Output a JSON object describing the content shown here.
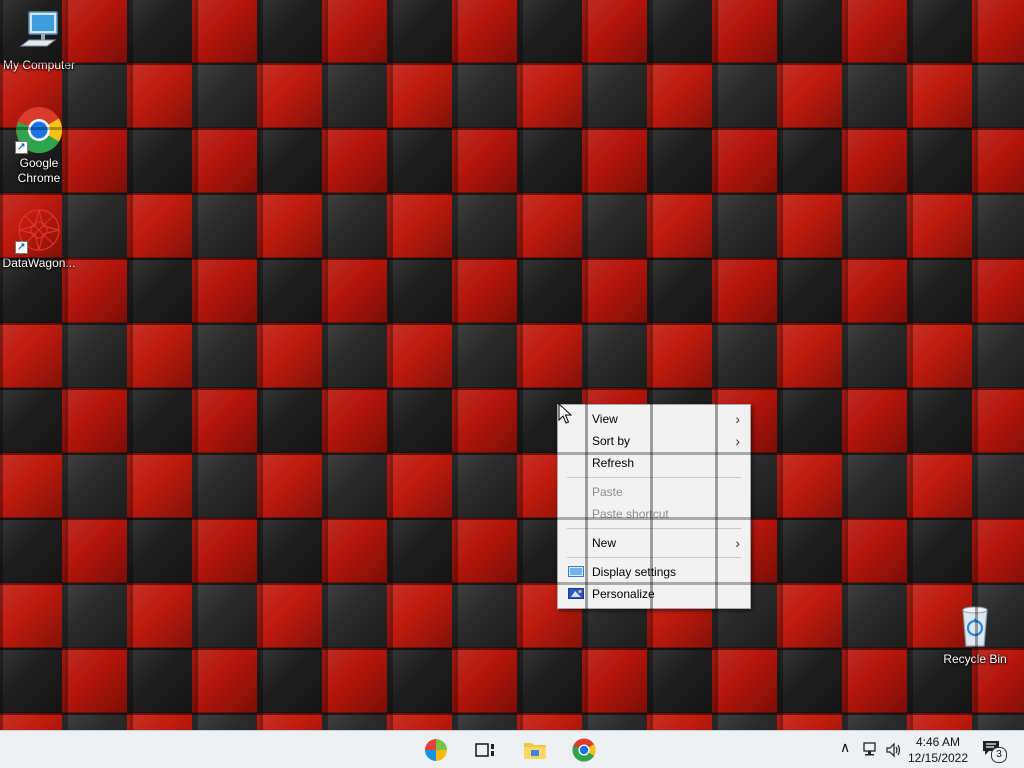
{
  "desktop_icons": [
    {
      "label": "My Computer",
      "icon": "computer-icon"
    },
    {
      "label": "Google Chrome",
      "icon": "chrome-icon"
    },
    {
      "label": "DataWagon...",
      "icon": "datawagon-icon"
    },
    {
      "label": "Recycle Bin",
      "icon": "recycle-bin-icon"
    }
  ],
  "context_menu": {
    "items": [
      {
        "label": "View",
        "submenu": true,
        "enabled": true
      },
      {
        "label": "Sort by",
        "submenu": true,
        "enabled": true
      },
      {
        "label": "Refresh",
        "submenu": false,
        "enabled": true
      },
      {
        "label": "Paste",
        "submenu": false,
        "enabled": false
      },
      {
        "label": "Paste shortcut",
        "submenu": false,
        "enabled": false
      },
      {
        "label": "New",
        "submenu": true,
        "enabled": true
      },
      {
        "label": "Display settings",
        "submenu": false,
        "enabled": true,
        "icon": "display-settings-icon"
      },
      {
        "label": "Personalize",
        "submenu": false,
        "enabled": true,
        "icon": "personalize-icon"
      }
    ],
    "chevron": "›"
  },
  "taskbar": {
    "apps": [
      "start-icon",
      "task-view-icon",
      "file-explorer-icon",
      "chrome-icon"
    ],
    "tray": {
      "chevron": "∧",
      "time": "4:46 AM",
      "date": "12/15/2022",
      "notification_count": "3"
    }
  },
  "colors": {
    "wallpaper_red": "#b5150b",
    "wallpaper_black": "#1e1e1e",
    "taskbar_bg": "#eef1f4",
    "menu_bg": "#f2f2f2"
  }
}
